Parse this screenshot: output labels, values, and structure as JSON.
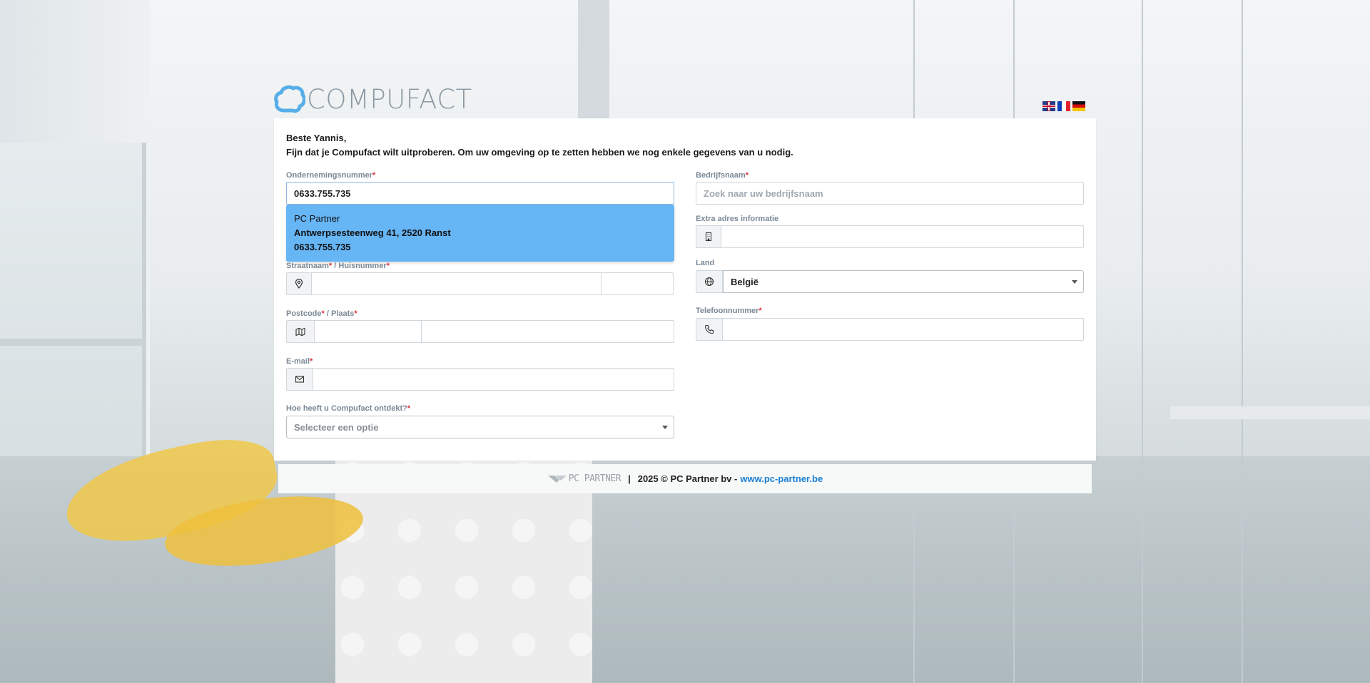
{
  "brand": {
    "name": "COMPUFACT"
  },
  "languages": [
    {
      "code": "en",
      "icon": "uk-flag-icon"
    },
    {
      "code": "fr",
      "icon": "france-flag-icon"
    },
    {
      "code": "de",
      "icon": "germany-flag-icon"
    }
  ],
  "greeting": {
    "line1": "Beste Yannis,",
    "line2": "Fijn dat je Compufact wilt uitproberen. Om uw omgeving op te zetten hebben we nog enkele gegevens van u nodig."
  },
  "form": {
    "company_number": {
      "label": "Ondernemingsnummer",
      "required": "*",
      "value": "0633.755.735"
    },
    "suggestion": {
      "name": "PC Partner",
      "address": "Antwerpsesteenweg 41, 2520 Ranst",
      "number": "0633.755.735"
    },
    "street": {
      "label": "Straatnaam",
      "required": "*",
      "label2": " / Huisnummer",
      "required2": "*",
      "value": "",
      "number_value": ""
    },
    "postal": {
      "label": "Postcode",
      "required": "*",
      "label2": " / Plaats",
      "required2": "*",
      "value": "",
      "city_value": ""
    },
    "email": {
      "label": "E-mail",
      "required": "*",
      "value": ""
    },
    "discovery": {
      "label": "Hoe heeft u Compufact ontdekt?",
      "required": "*",
      "placeholder": "Selecteer een optie"
    },
    "company_name": {
      "label": "Bedrijfsnaam",
      "required": "*",
      "placeholder": "Zoek naar uw bedrijfsnaam",
      "value": ""
    },
    "extra_address": {
      "label": "Extra adres informatie",
      "value": ""
    },
    "country": {
      "label": "Land",
      "value": "België"
    },
    "phone": {
      "label": "Telefoonnummer",
      "required": "*",
      "value": ""
    }
  },
  "footer": {
    "partner_logo": "PC PARTNER",
    "separator": "|",
    "copyright": "2025 © PC Partner bv -",
    "link": "www.pc-partner.be"
  },
  "colors": {
    "accent": "#66b5f5",
    "required": "#d9323a",
    "link": "#1a7fd3",
    "label": "#7a8996"
  }
}
